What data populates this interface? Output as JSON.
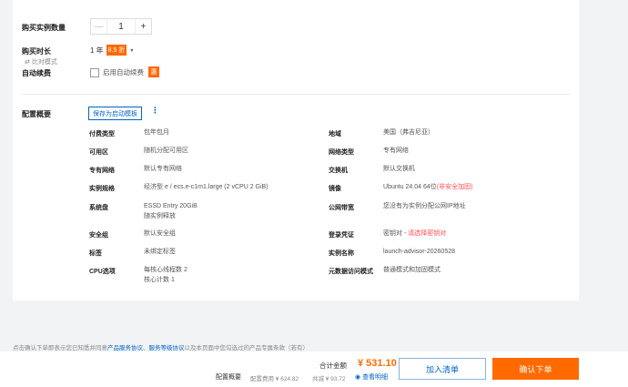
{
  "purchase": {
    "quantity_label": "购买实例数量",
    "quantity_value": "1",
    "minus": "—",
    "plus": "+",
    "duration_label": "购买时长",
    "duration_value": "1 年",
    "duration_discount": "8.5 折",
    "duration_caret": "▾",
    "compare_label": "比对模式",
    "compare_icon": "⇄",
    "autorenew_label": "自动续费",
    "autorenew_checkbox_label": "启用自动续费",
    "autorenew_badge": "惠"
  },
  "summary": {
    "title": "配置概要",
    "save_template": "保存为启动模板",
    "more": "⋮",
    "rows_left": [
      {
        "key": "付费类型",
        "value": "包年包月"
      },
      {
        "key": "可用区",
        "value": "随机分配可用区"
      },
      {
        "key": "专有网络",
        "value": "默认专有网络"
      },
      {
        "key": "实例规格",
        "value": "经济型 e / ecs.e-c1m1.large (2 vCPU 2 GiB)"
      },
      {
        "key": "系统盘",
        "value": "ESSD Entry 20GiB",
        "value2": "随实例释放"
      },
      {
        "key": "安全组",
        "value": "默认安全组"
      },
      {
        "key": "标签",
        "value": "未绑定标签"
      },
      {
        "key": "CPU选项",
        "value": "每核心线程数 2",
        "value2": "核心计数 1"
      }
    ],
    "rows_right": [
      {
        "key": "地域",
        "value": "美国（弗吉尼亚）"
      },
      {
        "key": "网络类型",
        "value": "专有网络"
      },
      {
        "key": "交换机",
        "value": "默认交换机"
      },
      {
        "key": "镜像",
        "value": "Ubuntu 24.04 64位",
        "value_red": "(非安全加固)"
      },
      {
        "key": "公网带宽",
        "value": "您没有为实例分配公网IP地址"
      },
      {
        "key": "登录凭证",
        "value": "密钥对 - ",
        "value_red": "请选择密钥对"
      },
      {
        "key": "实例名称",
        "value": "launch-advisor-20260528"
      },
      {
        "key": "元数据访问模式",
        "value": "普通模式和加固模式"
      }
    ]
  },
  "footer": {
    "notice_prefix": "点击确认下单即表示您已知悉并同意",
    "link1": "产品服务协议",
    "sep": "、",
    "link2": "服务等级协议",
    "notice_suffix": "以及本页面中您勾选过的产品专属条款（若有）",
    "total_label": "合计金额",
    "total_value": "¥ 531.10",
    "config_label": "配置概要",
    "fee": "配置费用 ¥ 624.82",
    "saving": "共减 ¥ 93.72",
    "detail_link": "查看明细",
    "detail_icon": "◉",
    "add_cart": "加入清单",
    "confirm_order": "确认下单"
  },
  "colors": {
    "accent": "#ff6a00",
    "link": "#0064c8",
    "warning": "#ff4d4f"
  }
}
